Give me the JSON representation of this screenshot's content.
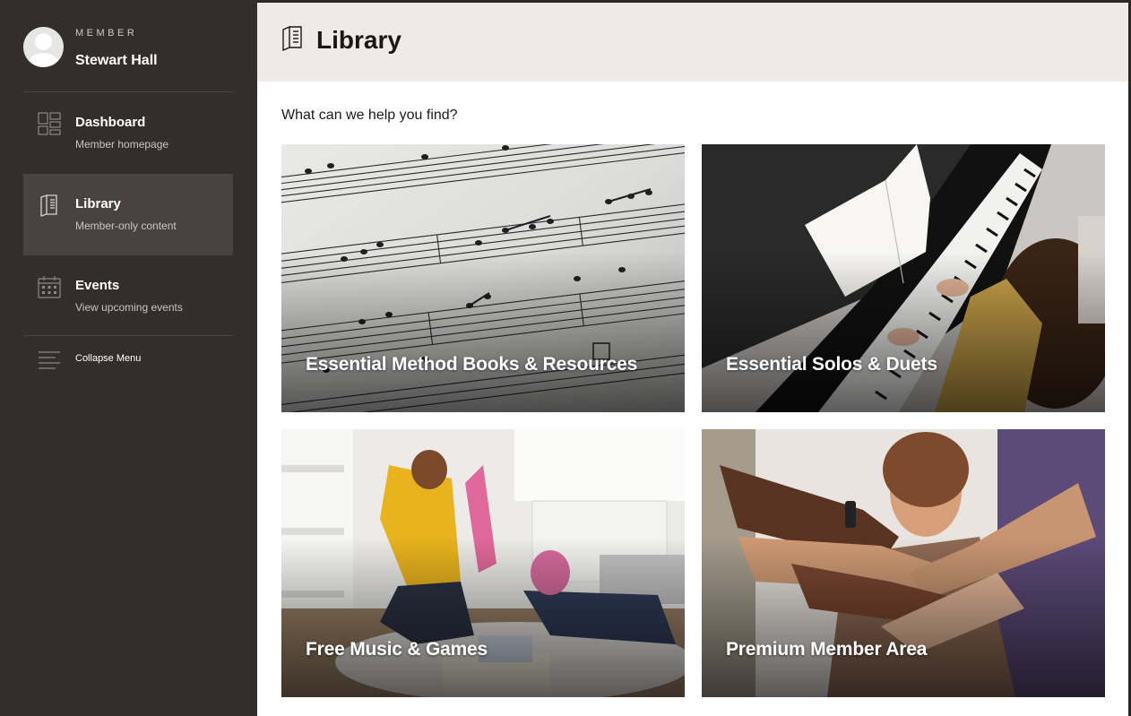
{
  "member": {
    "role": "MEMBER",
    "name": "Stewart Hall"
  },
  "nav": {
    "items": [
      {
        "title": "Dashboard",
        "subtitle": "Member homepage",
        "icon": "dashboard-grid-icon",
        "active": false
      },
      {
        "title": "Library",
        "subtitle": "Member-only content",
        "icon": "book-icon",
        "active": true
      },
      {
        "title": "Events",
        "subtitle": "View upcoming events",
        "icon": "calendar-icon",
        "active": false
      }
    ],
    "collapse_label": "Collapse Menu"
  },
  "header": {
    "title": "Library",
    "icon": "book-icon"
  },
  "prompt": "What can we help you find?",
  "cards": [
    {
      "title": "Essential Method Books & Resources",
      "image": "sheet-music-photo"
    },
    {
      "title": "Essential Solos & Duets",
      "image": "piano-player-photo"
    },
    {
      "title": "Free Music & Games",
      "image": "kids-playing-photo"
    },
    {
      "title": "Premium Member Area",
      "image": "hands-stacked-photo"
    }
  ],
  "colors": {
    "sidebar_bg": "#332d2b",
    "sidebar_active": "#4a4240",
    "header_bg": "#f1e9e7",
    "text_dark": "#1b1716"
  }
}
